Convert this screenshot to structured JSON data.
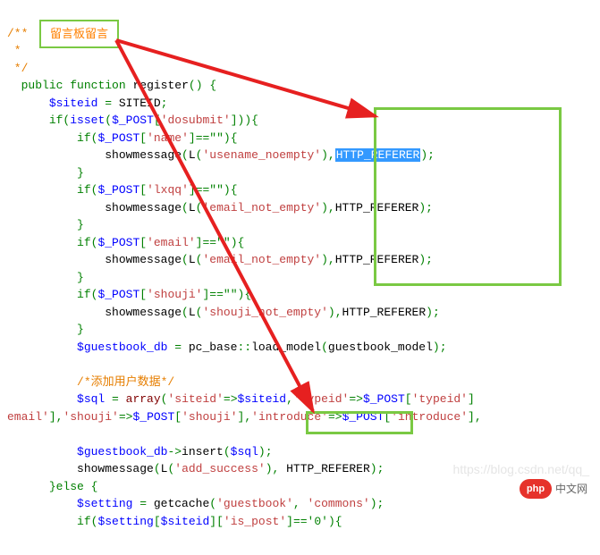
{
  "annotation": {
    "title": "留言板留言"
  },
  "code": {
    "comment_open": "/**",
    "comment_mid": " *",
    "comment_close": " */",
    "kw_public": "public",
    "kw_function": "function",
    "fn_name": "register",
    "paren_open": "()",
    "brace_open": "{",
    "brace_close": "}",
    "else_kw": "else",
    "var_siteid": "$siteid",
    "eq": " = ",
    "const_siteid": "SITEID",
    "semi": ";",
    "if_kw": "if",
    "isset_fn": "isset",
    "post_var": "$_POST",
    "key_dosubmit": "'dosubmit'",
    "key_name": "'name'",
    "key_lxqq": "'lxqq'",
    "key_email": "'email'",
    "key_shouji": "'shouji'",
    "key_typeid": "'typeid'",
    "key_introduce": "'introduce'",
    "eqeq_empty": "==\"\"",
    "showmessage": "showmessage",
    "L_fn": "L",
    "str_usename_noempty": "'usename_noempty'",
    "str_email_not_empty": "'email_not_empty'",
    "str_shouji_not_empty": "'shouji_not_empty'",
    "str_add_success": "'add_success'",
    "http_referer": "HTTP_REFERER",
    "var_guestbook_db": "$guestbook_db",
    "pc_base": "pc_base",
    "dcolon": "::",
    "load_model": "load_model",
    "guestbook_model": "guestbook_model",
    "comment_adduser": "/*添加用户数据*/",
    "var_sql": "$sql",
    "array_kw": "array",
    "key_siteid": "'siteid'",
    "arrow": "=>",
    "insert_fn": "insert",
    "arrow_obj": "->",
    "var_setting": "$setting",
    "getcache_fn": "getcache",
    "str_guestbook": "'guestbook'",
    "str_commons": "'commons'",
    "key_is_post": "'is_post'",
    "eqeq_zero": "=='0'",
    "lbracket": "[",
    "rbracket": "]",
    "lparen": "(",
    "rparen": ")",
    "comma": ",",
    "comma_sp": ", ",
    "cond_open": ")){",
    "cond_open2": "){",
    "email_prefix": "email'"
  },
  "watermark": "https://blog.csdn.net/qq_",
  "logo": {
    "icon": "php",
    "text": "中文网"
  }
}
